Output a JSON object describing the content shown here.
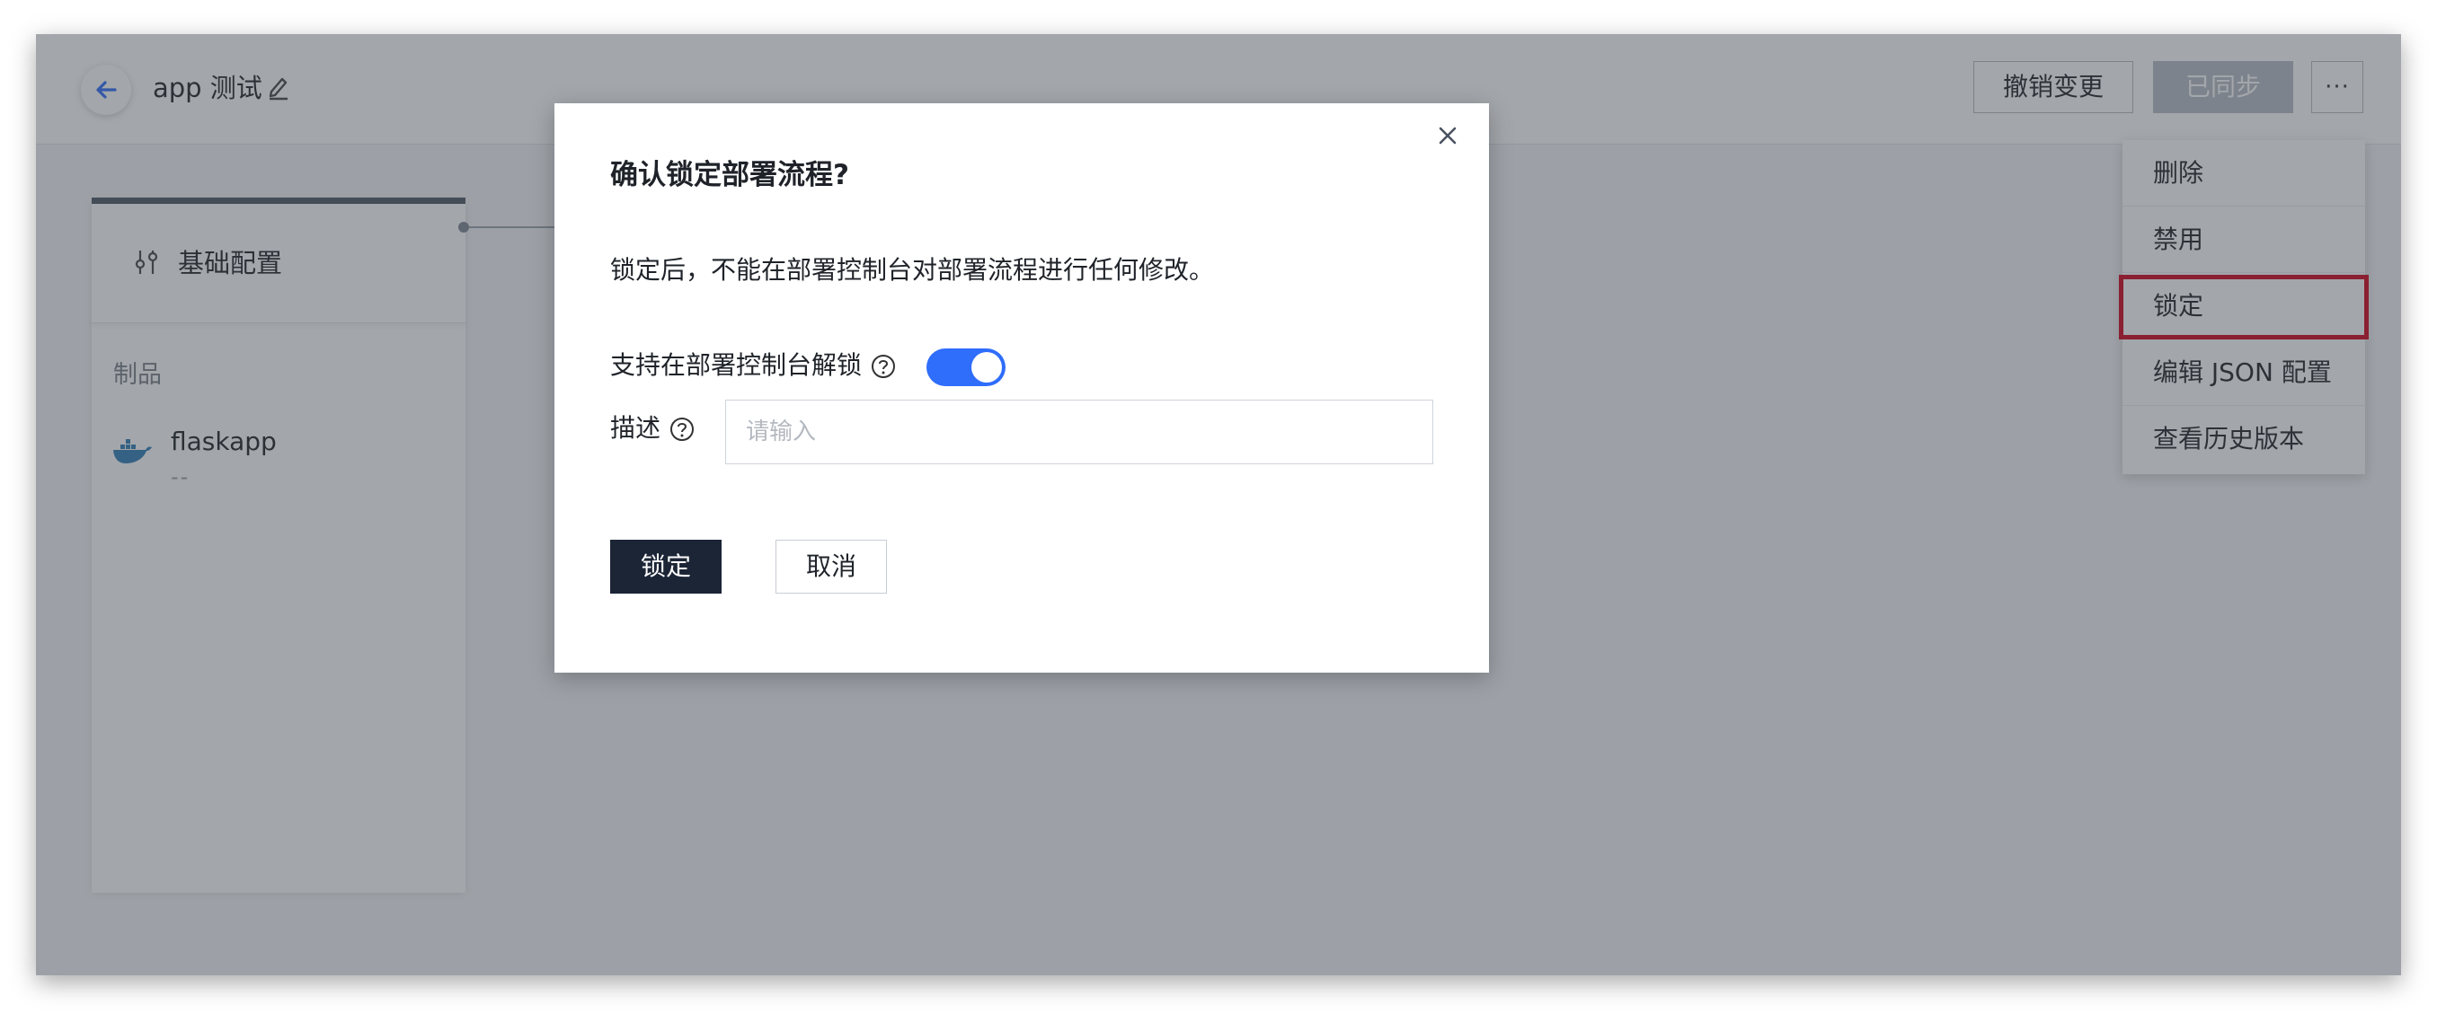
{
  "header": {
    "app_title": "app 测试",
    "undo_changes": "撤销变更",
    "synced": "已同步",
    "more_icon": "ellipsis-icon"
  },
  "card": {
    "title": "基础配置",
    "section_label": "制品",
    "artifact_name": "flaskapp",
    "artifact_sub": "--"
  },
  "dropdown": {
    "items": [
      "删除",
      "禁用",
      "锁定",
      "编辑 JSON 配置",
      "查看历史版本"
    ],
    "highlighted": "锁定"
  },
  "modal": {
    "title": "确认锁定部署流程?",
    "description": "锁定后，不能在部署控制台对部署流程进行任何修改。",
    "toggle_label": "支持在部署控制台解锁",
    "toggle_on": true,
    "desc_label": "描述",
    "desc_placeholder": "请输入",
    "confirm": "锁定",
    "cancel": "取消"
  },
  "colors": {
    "primary_blue": "#2f6dfb",
    "dark_button": "#1c2536",
    "highlight_red": "#d0021b"
  }
}
